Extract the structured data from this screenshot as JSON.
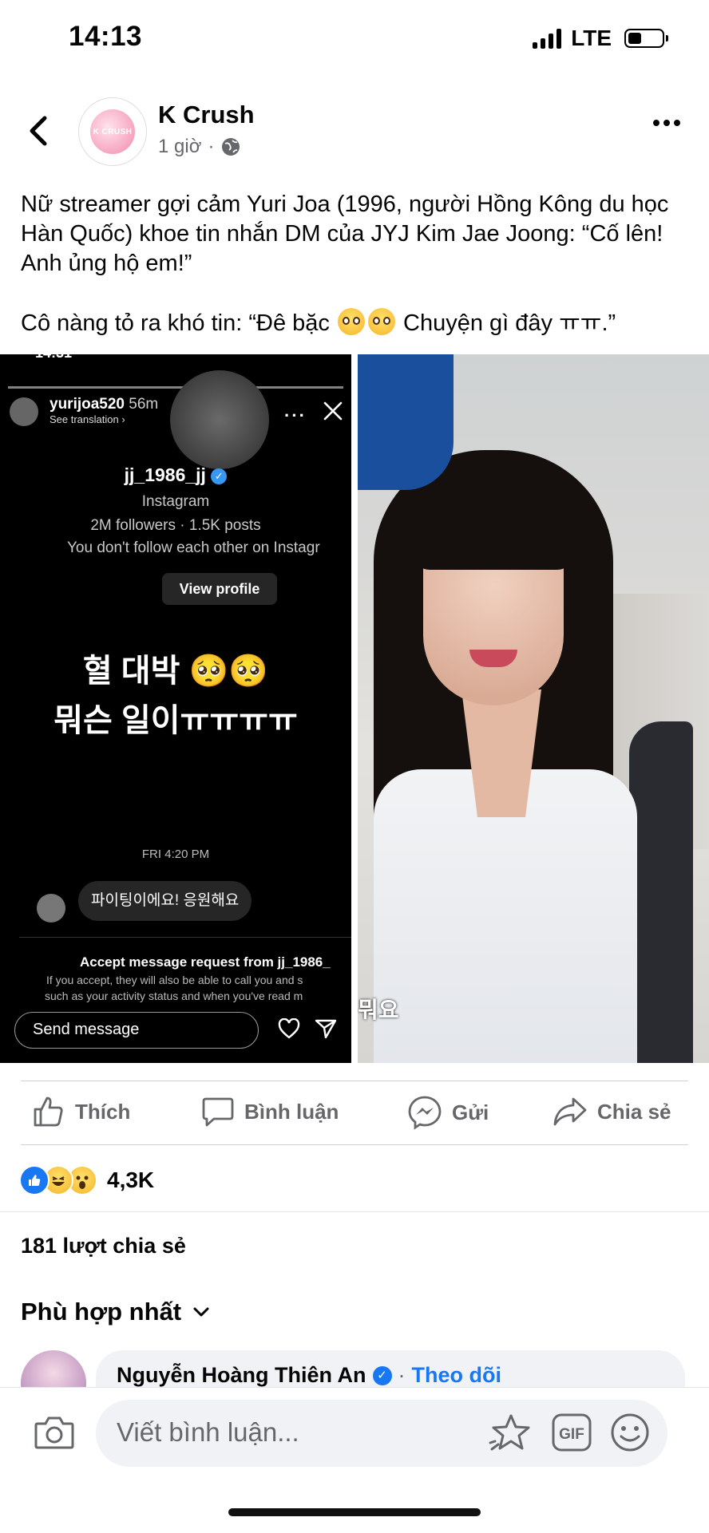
{
  "status_bar": {
    "time": "14:13",
    "network": "LTE",
    "battery_level": 0.35
  },
  "header": {
    "page_name": "K Crush",
    "post_time": "1 giờ",
    "separator": "·",
    "avatar_text": "K CRUSH"
  },
  "post": {
    "line1": "Nữ streamer gợi cảm Yuri Joa (1996, người Hồng Kông du học Hàn Quốc) khoe tin nhắn DM của JYJ Kim Jae Joong: “Cố lên! Anh ủng hộ em!”",
    "line2_before": "Cô nàng tỏ ra khó tin: “Đê bặc ",
    "line2_after": " Chuyện gì đây ㅠㅠ.”"
  },
  "ig_screenshot": {
    "status_time": "14:31",
    "story_user": "yurijoa520",
    "story_time": "56m",
    "see_translation": "See translation ›",
    "handle": "jj_1986_jj",
    "platform": "Instagram",
    "stats": "2M followers · 1.5K posts",
    "follow_note": "You don't follow each other on Instagr",
    "view_profile": "View profile",
    "korean_line1": "혈 대박 🥺🥺",
    "korean_line2": "뭐슨 일이ㅠㅠㅠㅠ",
    "date": "FRI 4:20 PM",
    "message": "파이팅이에요! 응원해요",
    "accept_title": "Accept message request from jj_1986_",
    "accept_note1": "If you accept, they will also be able to call you and s",
    "accept_note2": "such as your activity status and when you've read m",
    "send_placeholder": "Send message"
  },
  "video_caption": "뭐요",
  "actions": {
    "like": "Thích",
    "comment": "Bình luận",
    "send": "Gửi",
    "share": "Chia sẻ"
  },
  "reactions": {
    "count": "4,3K",
    "types": [
      "like-icon",
      "haha-icon",
      "wow-icon"
    ]
  },
  "shares_text": "181 lượt chia sẻ",
  "sort_label": "Phù hợp nhất",
  "comment": {
    "author": "Nguyễn Hoàng Thiên An",
    "follow": "Theo dõi",
    "dot": "·"
  },
  "composer": {
    "placeholder": "Viết bình luận..."
  },
  "colors": {
    "brand": "#1877f2",
    "secondary_text": "#65676b",
    "divider": "#ced0d4"
  }
}
